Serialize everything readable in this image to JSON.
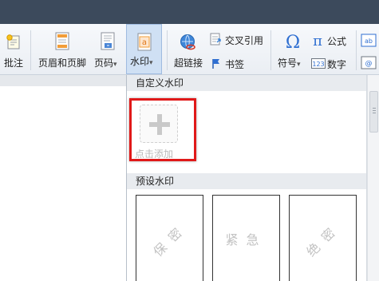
{
  "ribbon": {
    "comment": "批注",
    "header_footer": "页眉和页脚",
    "page_number": "页码",
    "watermark": "水印",
    "hyperlink": "超链接",
    "cross_reference": "交叉引用",
    "bookmark": "书签",
    "symbol": "符号",
    "formula": "公式",
    "number": "数字",
    "dropdown_arrow": "▾"
  },
  "watermark_panel": {
    "custom_title": "自定义水印",
    "add_label": "点击添加",
    "preset_title": "预设水印",
    "presets": [
      {
        "text": "保密"
      },
      {
        "text": "紧急"
      },
      {
        "text": "绝密"
      }
    ]
  },
  "colors": {
    "highlight": "#e01919",
    "active_button": "#cfe0f4",
    "titlebar": "#3c4a5c"
  }
}
